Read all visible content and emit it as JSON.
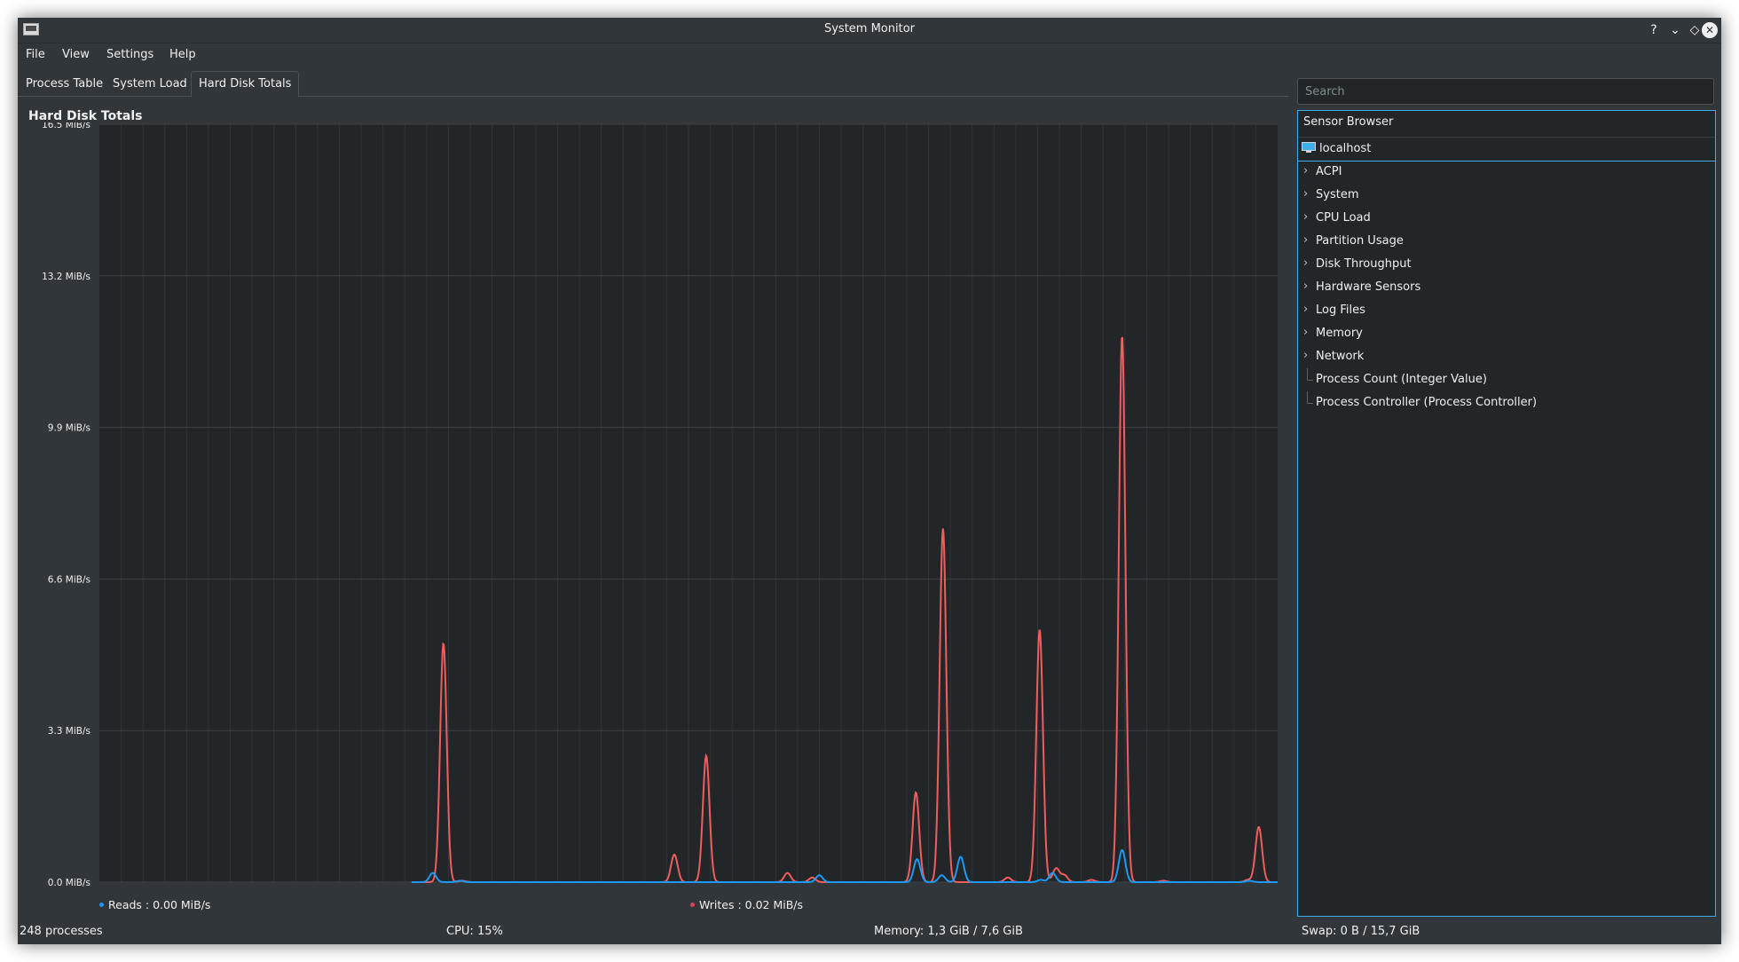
{
  "window": {
    "title": "System Monitor"
  },
  "titlebar_buttons": {
    "help": "?",
    "minimize": "⌄",
    "maximize": "◇",
    "close": "✕"
  },
  "menu": [
    "File",
    "View",
    "Settings",
    "Help"
  ],
  "tabs": [
    {
      "label": "Process Table",
      "active": false
    },
    {
      "label": "System Load",
      "active": false
    },
    {
      "label": "Hard Disk Totals",
      "active": true
    }
  ],
  "plot": {
    "title": "Hard Disk Totals",
    "legend": [
      {
        "label": "Reads : 0.00 MiB/s",
        "color": "#1d99f3"
      },
      {
        "label": "Writes : 0.02 MiB/s",
        "color": "#da4453"
      }
    ]
  },
  "chart_data": {
    "type": "line",
    "ylim": [
      0,
      16.5
    ],
    "y_ticks": [
      "16.5 MiB/s",
      "13.2 MiB/s",
      "9.9 MiB/s",
      "6.6 MiB/s",
      "3.3 MiB/s",
      "0.0 MiB/s"
    ],
    "grid": true,
    "x_range": [
      0,
      100
    ],
    "series": [
      {
        "name": "Writes",
        "color": "#f05d5d",
        "spikes": [
          [
            29.2,
            5.2
          ],
          [
            30.8,
            0.03
          ],
          [
            48.8,
            0.6
          ],
          [
            51.5,
            2.75
          ],
          [
            58.4,
            0.2
          ],
          [
            60.5,
            0.1
          ],
          [
            69.3,
            1.95
          ],
          [
            71.6,
            7.7
          ],
          [
            77.1,
            0.1
          ],
          [
            79.8,
            5.5
          ],
          [
            81.2,
            0.3
          ],
          [
            81.9,
            0.15
          ],
          [
            84.2,
            0.05
          ],
          [
            86.8,
            11.9
          ],
          [
            90.3,
            0.03
          ],
          [
            97.5,
            0.05
          ],
          [
            98.4,
            1.2
          ]
        ]
      },
      {
        "name": "Reads",
        "color": "#1d99f3",
        "spikes": [
          [
            28.3,
            0.2
          ],
          [
            30.6,
            0.03
          ],
          [
            61.1,
            0.15
          ],
          [
            69.4,
            0.5
          ],
          [
            71.5,
            0.15
          ],
          [
            73.1,
            0.55
          ],
          [
            79.9,
            0.05
          ],
          [
            80.9,
            0.2
          ],
          [
            86.8,
            0.7
          ],
          [
            97.6,
            0.03
          ]
        ]
      }
    ],
    "baseline_start_x": 26.5,
    "series_names_source": "legend"
  },
  "search": {
    "placeholder": "Search",
    "value": ""
  },
  "sensor_browser": {
    "header": "Sensor Browser",
    "root": "localhost",
    "items": [
      {
        "label": "ACPI",
        "expandable": true
      },
      {
        "label": "System",
        "expandable": true
      },
      {
        "label": "CPU Load",
        "expandable": true
      },
      {
        "label": "Partition Usage",
        "expandable": true
      },
      {
        "label": "Disk Throughput",
        "expandable": true
      },
      {
        "label": "Hardware Sensors",
        "expandable": true
      },
      {
        "label": "Log Files",
        "expandable": true
      },
      {
        "label": "Memory",
        "expandable": true
      },
      {
        "label": "Network",
        "expandable": true
      },
      {
        "label": "Process Count (Integer Value)",
        "expandable": false
      },
      {
        "label": "Process Controller (Process Controller)",
        "expandable": false
      }
    ]
  },
  "status": {
    "processes": "248 processes",
    "cpu": "CPU: 15%",
    "memory": "Memory: 1,3 GiB / 7,6 GiB",
    "swap": "Swap: 0 B / 15,7 GiB"
  }
}
